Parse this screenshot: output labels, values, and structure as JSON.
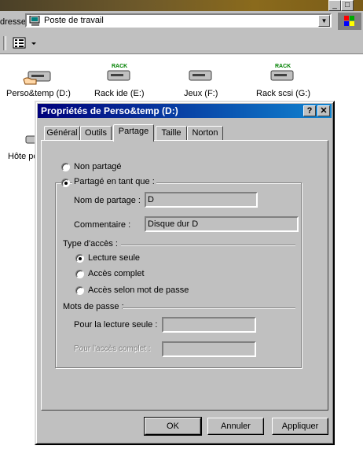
{
  "window": {
    "title_buttons": [
      "_",
      "□"
    ]
  },
  "address_bar": {
    "label": "dresse",
    "value": "Poste de travail"
  },
  "desktop": {
    "drives": [
      {
        "label": "Perso&temp (D:)",
        "rack": ""
      },
      {
        "label": "Rack ide (E:)",
        "rack": "RACK"
      },
      {
        "label": "Jeux (F:)",
        "rack": ""
      },
      {
        "label": "Rack scsi (G:)",
        "rack": "RACK"
      },
      {
        "label": "Hôte po",
        "rack": ""
      }
    ]
  },
  "dialog": {
    "title": "Propriétés de Perso&temp (D:)",
    "help_button": "?",
    "close_button": "✕",
    "tabs": [
      "Général",
      "Outils",
      "Partage",
      "Taille",
      "Norton"
    ],
    "active_tab": "Partage",
    "sharing": {
      "not_shared": "Non partagé",
      "shared_as": "Partagé en tant que :",
      "share_name_label": "Nom de partage :",
      "share_name_value": "D",
      "comment_label": "Commentaire :",
      "comment_value": "Disque dur D",
      "access_type_label": "Type d'accès :",
      "read_only": "Lecture seule",
      "full_access": "Accès complet",
      "depends_on_password": "Accès selon mot de passe",
      "passwords_label": "Mots de passe :",
      "read_only_password_label": "Pour la lecture seule :",
      "full_access_password_label": "Pour l'accès complet :"
    },
    "buttons": {
      "ok": "OK",
      "cancel": "Annuler",
      "apply": "Appliquer"
    }
  }
}
